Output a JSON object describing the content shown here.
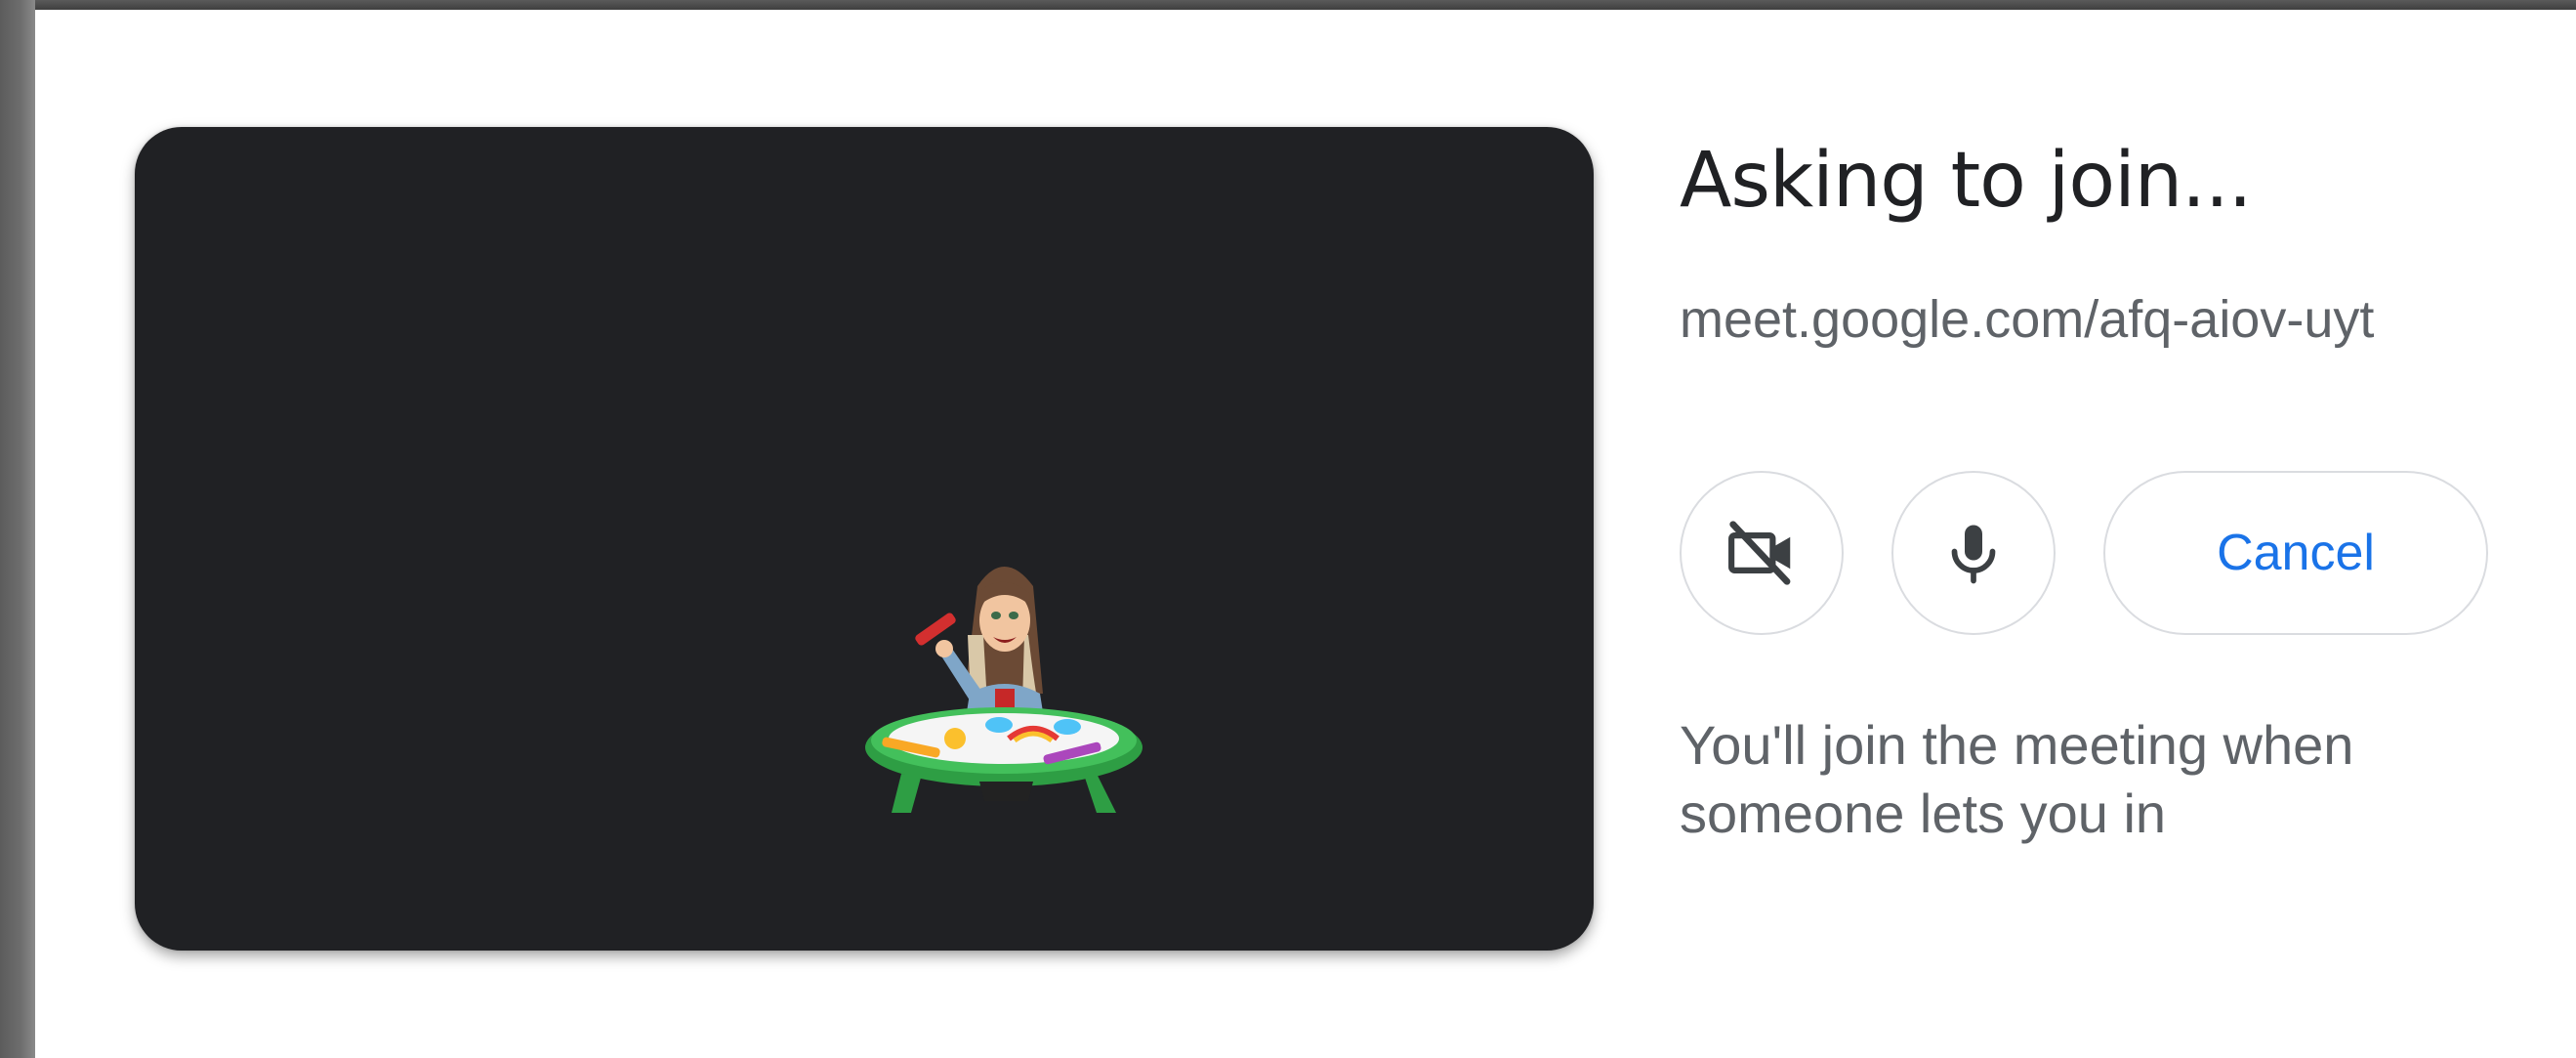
{
  "status": {
    "title": "Asking to join...",
    "meeting_url": "meet.google.com/afq-aiov-uyt",
    "info_message": "You'll join the meeting when someone lets you in"
  },
  "controls": {
    "camera_icon": "camera-off-icon",
    "mic_icon": "microphone-icon",
    "cancel_label": "Cancel"
  },
  "preview": {
    "avatar": "bitmoji-drawing-at-table"
  },
  "colors": {
    "preview_bg": "#202124",
    "accent": "#1a73e8",
    "text_primary": "#202124",
    "text_secondary": "#5f6368",
    "border": "#dadce0"
  }
}
